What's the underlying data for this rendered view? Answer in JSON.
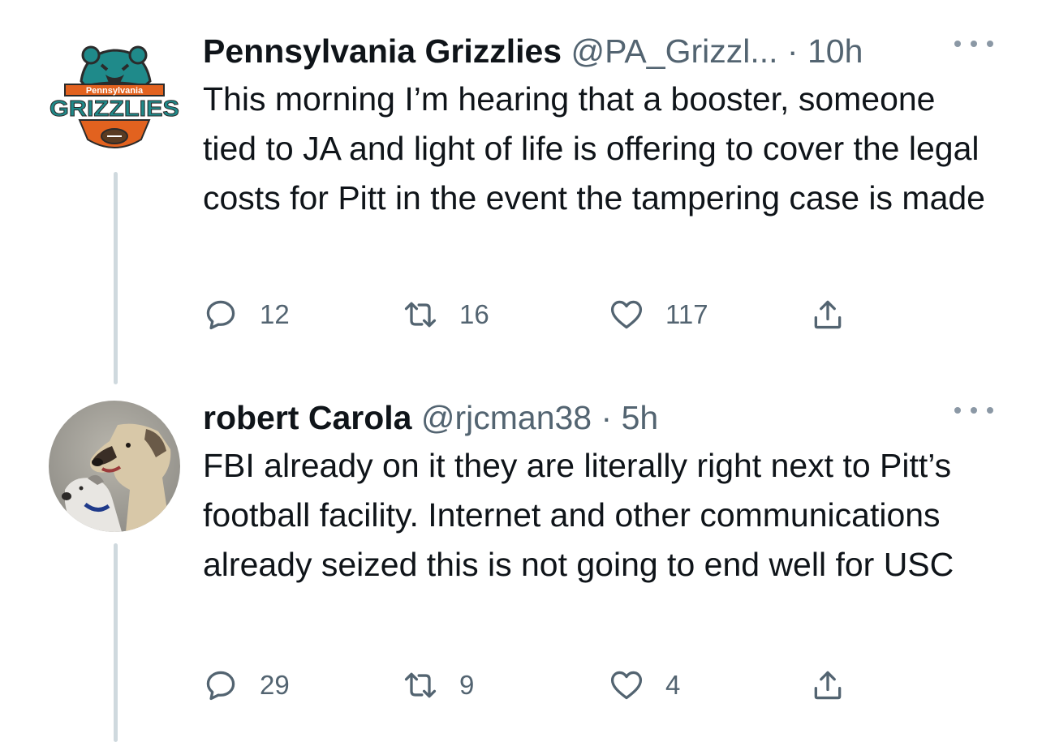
{
  "tweets": [
    {
      "display_name": "Pennsylvania Grizzlies",
      "handle": "@PA_Grizzl...",
      "separator": "·",
      "time": "10h",
      "text": "This morning I’m hearing that a booster, someone tied to JA and light of life is offering to cover the legal costs for Pitt in the event the tampering case is made",
      "avatar": {
        "logo_small_text": "Pennsylvania",
        "logo_big_text": "GRIZZLIES",
        "colors": {
          "teal": "#1f8a8a",
          "orange": "#e2621f",
          "dark": "#2b2b2b"
        }
      },
      "replies": "12",
      "retweets": "16",
      "likes": "117"
    },
    {
      "display_name": "robert Carola",
      "handle": "@rjcman38",
      "separator": "·",
      "time": "5h",
      "text": "FBI already on it they are literally right next to Pitt’s football facility. Internet and other communications already seized this is not going to end well for USC",
      "avatar": {
        "description": "two dogs photo"
      },
      "replies": "29",
      "retweets": "9",
      "likes": "4"
    }
  ],
  "icons": {
    "reply": "reply-icon",
    "retweet": "retweet-icon",
    "like": "like-icon",
    "share": "share-icon",
    "more": "more-icon"
  },
  "colors": {
    "text": "#0f1419",
    "secondary": "#536471",
    "thread_line": "#cfd9de"
  }
}
